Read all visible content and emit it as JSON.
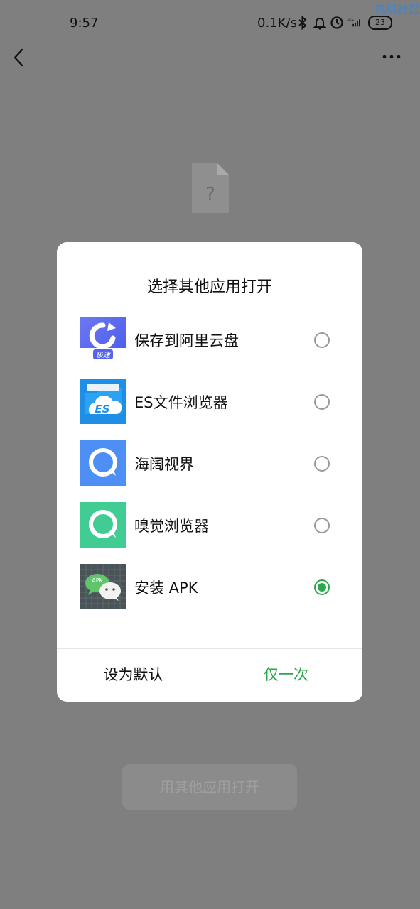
{
  "status_bar": {
    "time": "9:57",
    "net_speed": "0.1K/s",
    "icons": [
      "bluetooth-icon",
      "alarm-bell-icon",
      "clock-icon",
      "signal-4g-icon"
    ],
    "signal_label": "4G+",
    "battery": "23"
  },
  "watermark": "搞机社区",
  "nav": {
    "back_icon": "chevron-left-icon",
    "more_icon": "more-dots-icon"
  },
  "file_placeholder": {
    "icon": "unknown-file-icon",
    "glyph": "?"
  },
  "background_button": {
    "label": "用其他应用打开"
  },
  "dialog": {
    "title": "选择其他应用打开",
    "apps": [
      {
        "label": "保存到阿里云盘",
        "icon": "aliyun-drive-icon",
        "icon_text": "极速",
        "selected": false
      },
      {
        "label": "ES文件浏览器",
        "icon": "es-file-explorer-icon",
        "icon_text": "ES",
        "selected": false
      },
      {
        "label": "海阔视界",
        "icon": "haikuo-browser-icon",
        "selected": false
      },
      {
        "label": "嗅觉浏览器",
        "icon": "xiujue-browser-icon",
        "selected": false
      },
      {
        "label": "安装 APK",
        "icon": "apk-installer-icon",
        "icon_text": "APK",
        "selected": true
      }
    ],
    "set_default_label": "设为默认",
    "just_once_label": "仅一次"
  },
  "colors": {
    "overlay": "#7f7f7f",
    "accent_green": "#2aa84a",
    "link_blue": "#3a86d6"
  }
}
